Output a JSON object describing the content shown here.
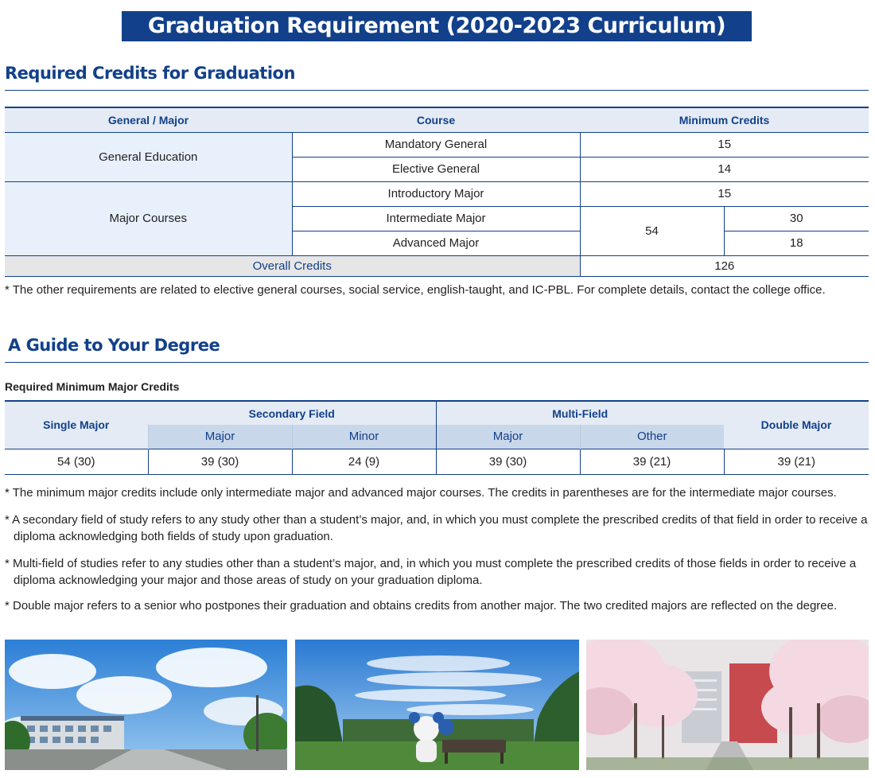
{
  "banner": {
    "title": "Graduation Requirement (2020-2023 Curriculum)"
  },
  "section1": {
    "title": "Required Credits for Graduation",
    "headers": [
      "General / Major",
      "Course",
      "Minimum Credits"
    ],
    "general_label": "General Education",
    "mandatory_general": {
      "course": "Mandatory General",
      "credits": "15"
    },
    "elective_general": {
      "course": "Elective General",
      "credits": "14"
    },
    "major_label": "Major Courses",
    "introductory_major": {
      "course": "Introductory Major",
      "credits": "15"
    },
    "intermediate_major": {
      "course": "Intermediate Major",
      "credits": "30"
    },
    "advanced_major": {
      "course": "Advanced Major",
      "credits": "18"
    },
    "major_combined_credits": "54",
    "overall_label": "Overall Credits",
    "overall_credits": "126",
    "note": "* The other requirements are related to elective general courses, social service, english-taught, and IC-PBL. For complete details, contact the college office."
  },
  "section2": {
    "title": "A Guide to Your Degree",
    "subtitle": "Required Minimum Major Credits",
    "headers": {
      "single_major": "Single Major",
      "secondary_field": "Secondary Field",
      "multi_field": "Multi-Field",
      "double_major": "Double Major",
      "secondary_major": "Major",
      "secondary_minor": "Minor",
      "multi_major": "Major",
      "multi_other": "Other"
    },
    "values": {
      "single_major": "54 (30)",
      "secondary_major": "39 (30)",
      "secondary_minor": "24 (9)",
      "multi_major": "39 (30)",
      "multi_other": "39 (21)",
      "double_major": "39 (21)"
    },
    "notes": [
      "* The minimum major credits include only intermediate major and advanced major courses. The credits in parentheses are for the intermediate major courses.",
      "* A secondary field of study refers to any study other than a student’s major, and, in which you must complete the prescribed credits of that field in order to receive a diploma acknowledging both fields of study upon graduation.",
      "* Multi-field of studies refer to any studies other than a student’s major, and, in which you must complete the prescribed credits of those fields in order to receive a diploma acknowledging your major and those areas of study on your graduation diploma.",
      "* Double major refers to a senior who postpones their graduation and obtains credits from another major. The two credited majors are reflected on the degree."
    ]
  },
  "photos": {
    "items": [
      "campus-building-photo",
      "campus-mascot-photo",
      "cherry-blossom-photo"
    ]
  }
}
